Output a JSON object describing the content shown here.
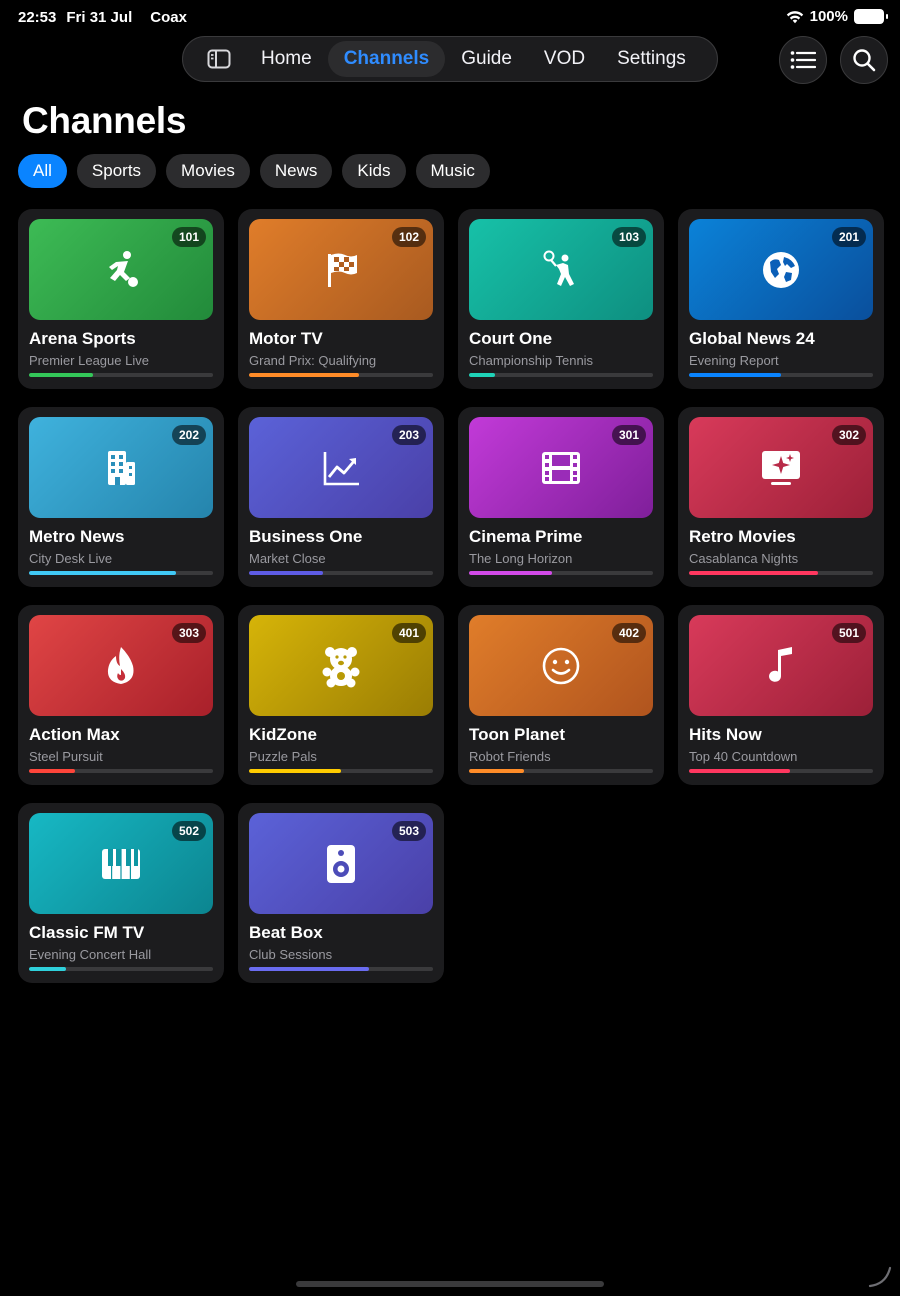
{
  "status": {
    "time": "22:53",
    "date": "Fri 31 Jul",
    "app": "Coax",
    "battery": "100%"
  },
  "nav": {
    "items": [
      {
        "label": "Home",
        "active": false
      },
      {
        "label": "Channels",
        "active": true
      },
      {
        "label": "Guide",
        "active": false
      },
      {
        "label": "VOD",
        "active": false
      },
      {
        "label": "Settings",
        "active": false
      }
    ]
  },
  "page": {
    "title": "Channels"
  },
  "filters": [
    {
      "label": "All",
      "active": true
    },
    {
      "label": "Sports",
      "active": false
    },
    {
      "label": "Movies",
      "active": false
    },
    {
      "label": "News",
      "active": false
    },
    {
      "label": "Kids",
      "active": false
    },
    {
      "label": "Music",
      "active": false
    }
  ],
  "channels": [
    {
      "number": "101",
      "name": "Arena Sports",
      "program": "Premier League Live",
      "progress": 0.35,
      "icon": "soccer-player-icon",
      "gradient": [
        "#3dbb55",
        "#228a3a"
      ],
      "accent": "#34c759"
    },
    {
      "number": "102",
      "name": "Motor TV",
      "program": "Grand Prix: Qualifying",
      "progress": 0.6,
      "icon": "checkered-flag-icon",
      "gradient": [
        "#e07d2a",
        "#a85a20"
      ],
      "accent": "#ff8c28"
    },
    {
      "number": "103",
      "name": "Court One",
      "program": "Championship Tennis",
      "progress": 0.14,
      "icon": "tennis-player-icon",
      "gradient": [
        "#17c1a8",
        "#0e8f80"
      ],
      "accent": "#1fd3b8"
    },
    {
      "number": "201",
      "name": "Global News 24",
      "program": "Evening Report",
      "progress": 0.5,
      "icon": "globe-icon",
      "gradient": [
        "#0b82d8",
        "#0a4f9c"
      ],
      "accent": "#0a84ff"
    },
    {
      "number": "202",
      "name": "Metro News",
      "program": "City Desk Live",
      "progress": 0.8,
      "icon": "building-icon",
      "gradient": [
        "#3fb2dd",
        "#2584ac"
      ],
      "accent": "#40c8f5"
    },
    {
      "number": "203",
      "name": "Business One",
      "program": "Market Close",
      "progress": 0.4,
      "icon": "chart-up-icon",
      "gradient": [
        "#5b62d8",
        "#4a40a8"
      ],
      "accent": "#5e5ce6"
    },
    {
      "number": "301",
      "name": "Cinema Prime",
      "program": "The Long Horizon",
      "progress": 0.45,
      "icon": "film-icon",
      "gradient": [
        "#c23ad8",
        "#7f1f9a"
      ],
      "accent": "#d24ae8"
    },
    {
      "number": "302",
      "name": "Retro Movies",
      "program": "Casablanca Nights",
      "progress": 0.7,
      "icon": "tv-sparkle-icon",
      "gradient": [
        "#d83a5a",
        "#9c2038"
      ],
      "accent": "#ff375f"
    },
    {
      "number": "303",
      "name": "Action Max",
      "program": "Steel Pursuit",
      "progress": 0.25,
      "icon": "flame-icon",
      "gradient": [
        "#e04545",
        "#a8202a"
      ],
      "accent": "#ff453a"
    },
    {
      "number": "401",
      "name": "KidZone",
      "program": "Puzzle Pals",
      "progress": 0.5,
      "icon": "teddy-bear-icon",
      "gradient": [
        "#d6b408",
        "#9a7d04"
      ],
      "accent": "#ffcc00"
    },
    {
      "number": "402",
      "name": "Toon Planet",
      "program": "Robot Friends",
      "progress": 0.3,
      "icon": "smiley-icon",
      "gradient": [
        "#e07d2a",
        "#b0541e"
      ],
      "accent": "#ff8c28"
    },
    {
      "number": "501",
      "name": "Hits Now",
      "program": "Top 40 Countdown",
      "progress": 0.55,
      "icon": "music-note-icon",
      "gradient": [
        "#d83a5a",
        "#9c2038"
      ],
      "accent": "#ff375f"
    },
    {
      "number": "502",
      "name": "Classic FM TV",
      "program": "Evening Concert Hall",
      "progress": 0.2,
      "icon": "piano-keys-icon",
      "gradient": [
        "#17b8c4",
        "#0c8590"
      ],
      "accent": "#2fd0db"
    },
    {
      "number": "503",
      "name": "Beat Box",
      "program": "Club Sessions",
      "progress": 0.65,
      "icon": "speaker-icon",
      "gradient": [
        "#5b62d8",
        "#4a40a8"
      ],
      "accent": "#6a6cf0"
    }
  ]
}
